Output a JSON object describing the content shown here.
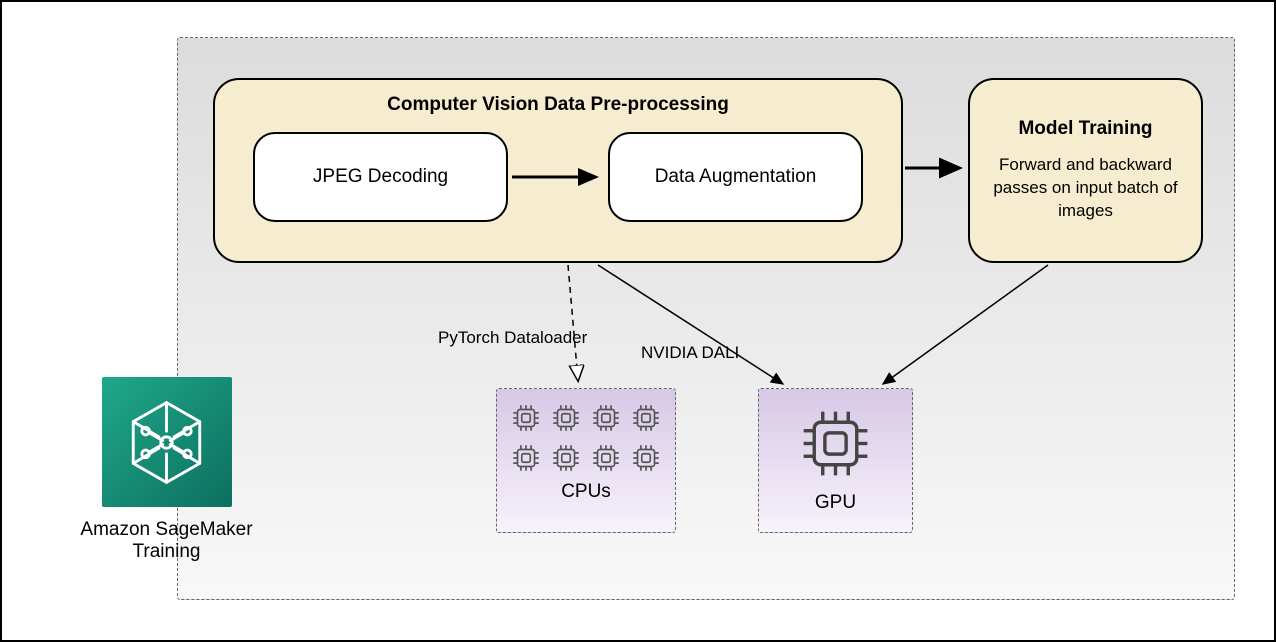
{
  "preprocessing": {
    "title": "Computer Vision Data Pre-processing",
    "step1": "JPEG Decoding",
    "step2": "Data Augmentation"
  },
  "training": {
    "title": "Model Training",
    "subtitle": "Forward and backward passes on input batch of images"
  },
  "hardware": {
    "cpus_label": "CPUs",
    "gpu_label": "GPU"
  },
  "labels": {
    "pytorch": "PyTorch Dataloader",
    "dali": "NVIDIA DALI"
  },
  "sagemaker": {
    "label": "Amazon SageMaker Training"
  }
}
